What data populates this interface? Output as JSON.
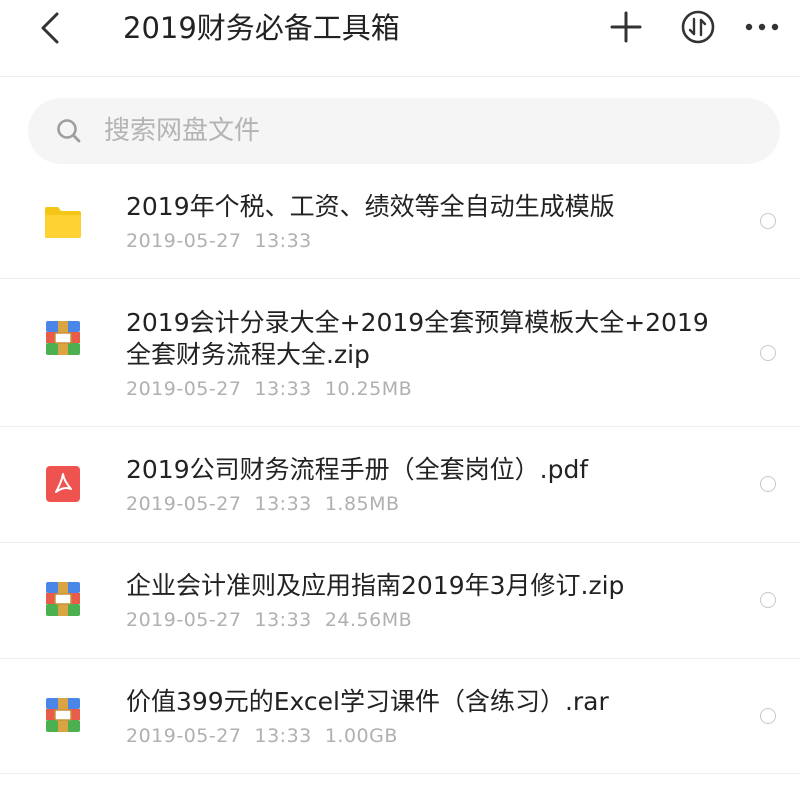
{
  "header": {
    "title": "2019财务必备工具箱",
    "back_icon": "back-arrow-icon",
    "add_icon": "plus-icon",
    "sort_icon": "sort-icon",
    "more_icon": "more-dots-icon"
  },
  "search": {
    "placeholder": "搜索网盘文件",
    "value": ""
  },
  "files": [
    {
      "type": "folder",
      "name": "2019年个税、工资、绩效等全自动生成模版",
      "meta": "2019-05-27  13:33"
    },
    {
      "type": "archive",
      "name": "2019会计分录大全+2019全套预算模板大全+2019全套财务流程大全.zip",
      "meta": "2019-05-27  13:33  10.25MB"
    },
    {
      "type": "pdf",
      "name": "2019公司财务流程手册（全套岗位）.pdf",
      "meta": "2019-05-27  13:33  1.85MB"
    },
    {
      "type": "archive",
      "name": "企业会计准则及应用指南2019年3月修订.zip",
      "meta": "2019-05-27  13:33  24.56MB"
    },
    {
      "type": "archive",
      "name": "价值399元的Excel学习课件（含练习）.rar",
      "meta": "2019-05-27  13:33  1.00GB"
    }
  ],
  "colors": {
    "folder": "#F5C518",
    "pdf": "#EF5350",
    "archive_blue": "#4A86E8",
    "archive_red": "#E85C4A",
    "archive_green": "#4CAF50",
    "archive_band": "#D9A441"
  }
}
